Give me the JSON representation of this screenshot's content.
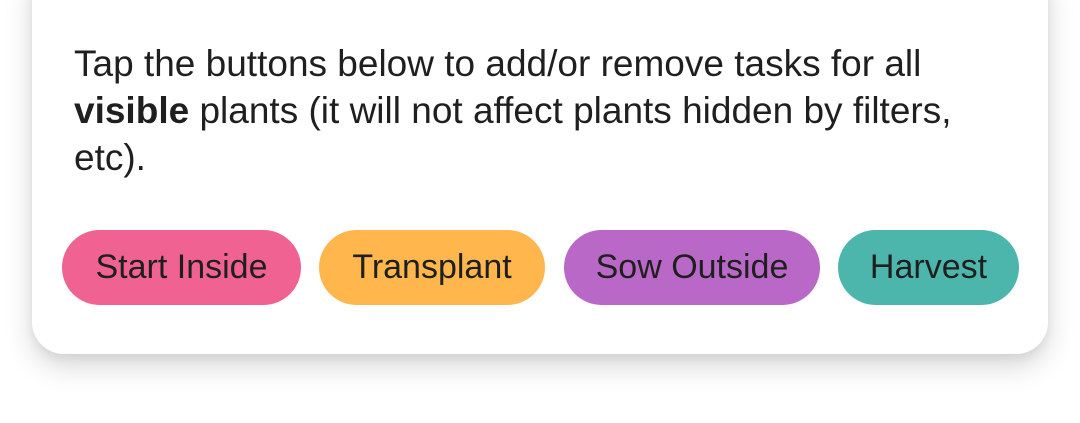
{
  "description": {
    "part1": "Tap the buttons below to add/or remove tasks for all ",
    "emphasis": "visible",
    "part2": " plants (it will not affect plants hidden by filters, etc)."
  },
  "buttons": [
    {
      "label": "Start Inside",
      "color": "#f06292"
    },
    {
      "label": "Transplant",
      "color": "#ffb74d"
    },
    {
      "label": "Sow Outside",
      "color": "#ba68c8"
    },
    {
      "label": "Harvest",
      "color": "#4db6ac"
    }
  ]
}
